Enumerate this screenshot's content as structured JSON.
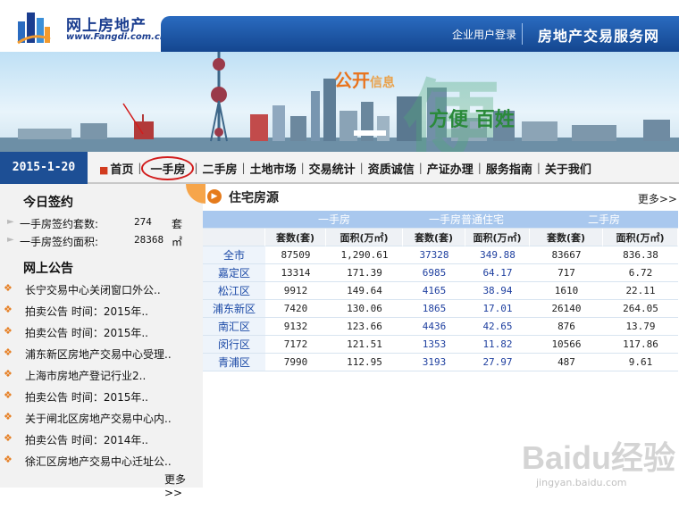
{
  "header": {
    "logo_text": "网上房地产",
    "logo_sub": "www.Fangdi.com.cn",
    "login_link": "企业用户登录",
    "service_title": "房地产交易服务网"
  },
  "banner": {
    "slogan_a": "公开",
    "slogan_b": "信息",
    "slogan_c": "方便",
    "slogan_d": "百姓",
    "big_char": "便"
  },
  "nav": {
    "date": "2015-1-20",
    "items": [
      "首页",
      "一手房",
      "二手房",
      "土地市场",
      "交易统计",
      "资质诚信",
      "产证办理",
      "服务指南",
      "关于我们"
    ]
  },
  "today": {
    "title": "今日签约",
    "rows": [
      {
        "label": "一手房签约套数:",
        "value": "274",
        "unit": "套"
      },
      {
        "label": "一手房签约面积:",
        "value": "28368",
        "unit": "㎡"
      }
    ]
  },
  "notices": {
    "title": "网上公告",
    "items": [
      "长宁交易中心关闭窗口外公..",
      "拍卖公告 时间：2015年..",
      "拍卖公告 时间：2015年..",
      "浦东新区房地产交易中心受理..",
      "上海市房地产登记行业2..",
      "拍卖公告 时间：2015年..",
      "关于闸北区房地产交易中心内..",
      "拍卖公告 时间：2014年..",
      "徐汇区房地产交易中心迁址公.."
    ],
    "more": "更多>>"
  },
  "residential": {
    "title": "住宅房源",
    "more": "更多>>",
    "groups": [
      "一手房",
      "一手房普通住宅",
      "二手房"
    ],
    "sub_headers": [
      "套数(套)",
      "面积(万㎡)",
      "套数(套)",
      "面积(万㎡)",
      "套数(套)",
      "面积(万㎡)"
    ],
    "rows": [
      {
        "area": "全市",
        "v": [
          "87509",
          "1,290.61",
          "37328",
          "349.88",
          "83667",
          "836.38"
        ]
      },
      {
        "area": "嘉定区",
        "v": [
          "13314",
          "171.39",
          "6985",
          "64.17",
          "717",
          "6.72"
        ]
      },
      {
        "area": "松江区",
        "v": [
          "9912",
          "149.64",
          "4165",
          "38.94",
          "1610",
          "22.11"
        ]
      },
      {
        "area": "浦东新区",
        "v": [
          "7420",
          "130.06",
          "1865",
          "17.01",
          "26140",
          "264.05"
        ]
      },
      {
        "area": "南汇区",
        "v": [
          "9132",
          "123.66",
          "4436",
          "42.65",
          "876",
          "13.79"
        ]
      },
      {
        "area": "闵行区",
        "v": [
          "7172",
          "121.51",
          "1353",
          "11.82",
          "10566",
          "117.86"
        ]
      },
      {
        "area": "青浦区",
        "v": [
          "7990",
          "112.95",
          "3193",
          "27.97",
          "487",
          "9.61"
        ]
      }
    ]
  },
  "watermark": {
    "main": "Baidu经验",
    "sub": "jingyan.baidu.com"
  },
  "colors": {
    "brand_blue": "#1d4f95",
    "header_blue": "#a9c8ee",
    "accent_orange": "#e57b1c",
    "circle_red": "#d21c1c"
  }
}
